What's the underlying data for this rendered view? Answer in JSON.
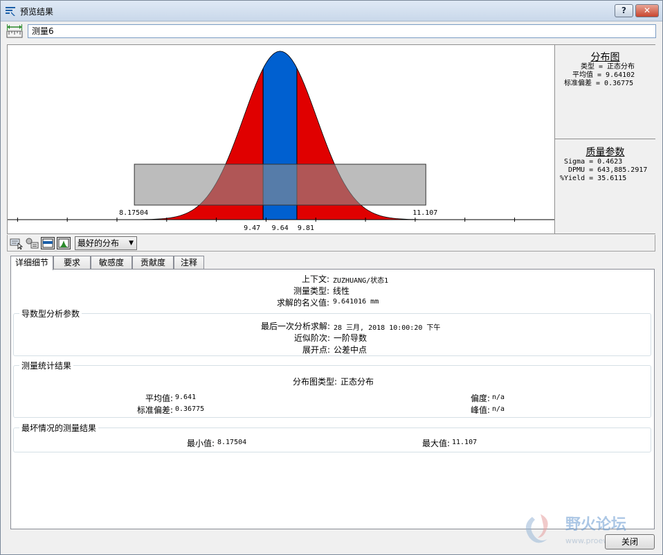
{
  "window": {
    "title": "预览结果",
    "help_label": "?",
    "close_label": "✕"
  },
  "measurement_name": "测量6",
  "chart_data": {
    "type": "area",
    "distribution": "normal",
    "mean": 9.64102,
    "stddev": 0.36775,
    "bands": [
      {
        "from": 9.47,
        "to": 9.81,
        "color": "#0060d0"
      }
    ],
    "tails_color": "#e00000",
    "tolerance_range": {
      "min": 8.17504,
      "max": 11.107,
      "color": "#909090"
    },
    "axis_labels": {
      "lower_limit": "8.17504",
      "upper_limit": "11.107",
      "band_low": "9.47",
      "band_mean": "9.64",
      "band_high": "9.81"
    },
    "xlim": [
      6.9,
      12.4
    ]
  },
  "distribution_box": {
    "title": "分布图",
    "lines": [
      "类型 = 正态分布",
      "平均值 = 9.64102",
      "标准偏差 = 0.36775"
    ]
  },
  "quality_box": {
    "title": "质量参数",
    "lines": [
      "Sigma = 0.4623",
      "DPMU = 643,885.2917",
      "%Yield = 35.6115"
    ]
  },
  "toolbar": {
    "distribution_select": "最好的分布"
  },
  "tabs": [
    "详细细节",
    "要求",
    "敏感度",
    "贡献度",
    "注释"
  ],
  "details": {
    "context_label": "上下文:",
    "context_value": "ZUZHUANG/状态1",
    "type_label": "测量类型:",
    "type_value": "线性",
    "nominal_label": "求解的名义值:",
    "nominal_value": "9.641016 mm",
    "derivative_group": "导数型分析参数",
    "last_solve_label": "最后一次分析求解:",
    "last_solve_value": "28 三月, 2018 10:00:20 下午",
    "approx_label": "近似阶次:",
    "approx_value": "一阶导数",
    "expansion_label": "展开点:",
    "expansion_value": "公差中点",
    "stats_group": "测量统计结果",
    "dist_type_label": "分布图类型:",
    "dist_type_value": "正态分布",
    "mean_label": "平均值:",
    "mean_value": "9.641",
    "std_label": "标准偏差:",
    "std_value": "0.36775",
    "skew_label": "偏度:",
    "skew_value": "n/a",
    "kurt_label": "峰值:",
    "kurt_value": "n/a",
    "worst_group": "最坏情况的测量结果",
    "min_label": "最小值:",
    "min_value": "8.17504",
    "max_label": "最大值:",
    "max_value": "11.107"
  },
  "close_button": "关闭",
  "watermark": {
    "text": "野火论坛",
    "url": "www.proewildfire.cn"
  }
}
